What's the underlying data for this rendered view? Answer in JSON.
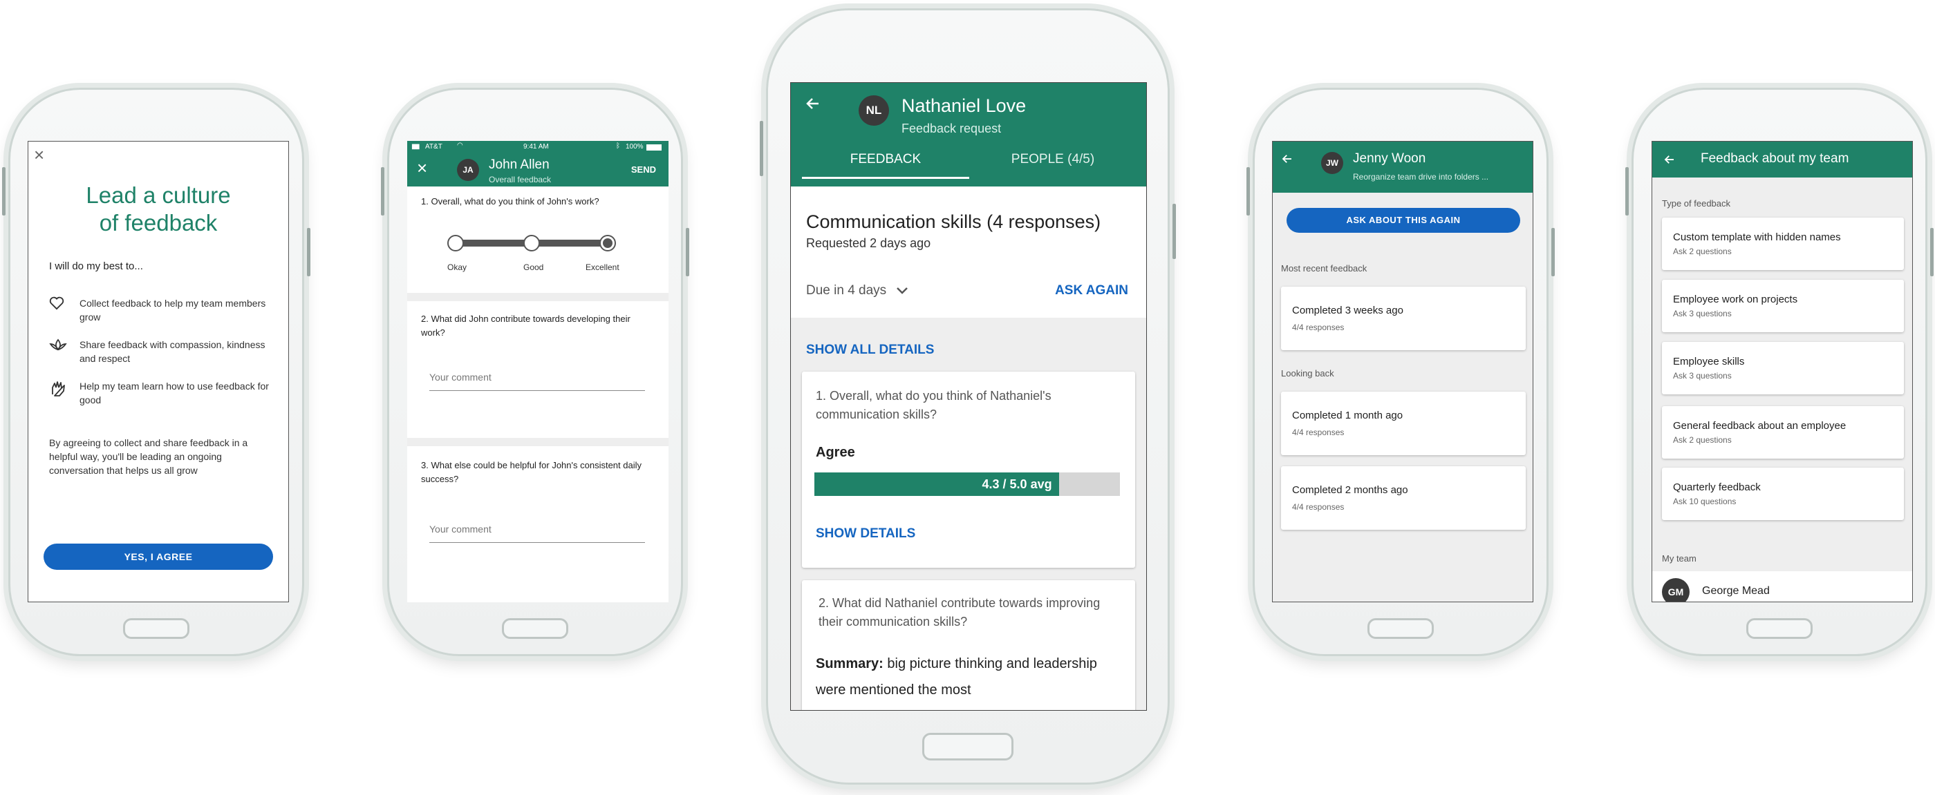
{
  "phone1": {
    "title_line1": "Lead a culture",
    "title_line2": "of feedback",
    "subtitle": "I will do my best to...",
    "pledges": [
      {
        "icon": "heart-icon",
        "text": "Collect feedback to help my team members grow"
      },
      {
        "icon": "lotus-icon",
        "text": "Share feedback with compassion, kindness and respect"
      },
      {
        "icon": "hands-icon",
        "text": "Help my team learn how to use feedback for good"
      }
    ],
    "agreement": "By agreeing to collect and share feedback in a helpful way, you'll be leading an ongoing conversation that helps us all grow",
    "agree_button": "YES, I AGREE"
  },
  "phone2": {
    "status": {
      "carrier": "AT&T",
      "time": "9:41 AM",
      "battery": "100%"
    },
    "avatar": "JA",
    "name": "John Allen",
    "subtitle": "Overall feedback",
    "send": "SEND",
    "q1": "1. Overall, what do you think of John's work?",
    "scale": [
      "Okay",
      "Good",
      "Excellent"
    ],
    "q2": "2. What did John contribute towards developing their work?",
    "comment_placeholder": "Your comment",
    "q3": "3. What else could be helpful for John's consistent daily success?",
    "comment_placeholder2": "Your comment"
  },
  "phone3": {
    "avatar": "NL",
    "name": "Nathaniel Love",
    "subtitle": "Feedback request",
    "tabs": [
      "FEEDBACK",
      "PEOPLE (4/5)"
    ],
    "heading": "Communication skills (4 responses)",
    "requested": "Requested 2 days ago",
    "due": "Due in 4 days",
    "ask_again": "ASK AGAIN",
    "show_all": "SHOW ALL DETAILS",
    "q1": "1. Overall, what do you think of Nathaniel's communication skills?",
    "q1_answer": "Agree",
    "avg_label": "4.3 / 5.0 avg",
    "avg_fraction": 0.8,
    "show_details": "SHOW DETAILS",
    "q2": "2. What did Nathaniel contribute towards improving their communication skills?",
    "summary_label": "Summary:",
    "summary_text": "big picture thinking and leadership were mentioned the most"
  },
  "phone4": {
    "avatar": "JW",
    "name": "Jenny Woon",
    "subtitle": "Reorganize team drive into folders ...",
    "ask_button": "ASK ABOUT THIS AGAIN",
    "recent_label": "Most recent feedback",
    "recent": [
      {
        "title": "Completed 3 weeks ago",
        "sub": "4/4 responses"
      }
    ],
    "back_label": "Looking back",
    "back": [
      {
        "title": "Completed 1 month ago",
        "sub": "4/4 responses"
      },
      {
        "title": "Completed 2 months ago",
        "sub": "4/4 responses"
      }
    ]
  },
  "phone5": {
    "title": "Feedback about my team",
    "type_label": "Type of feedback",
    "types": [
      {
        "title": "Custom template with hidden names",
        "sub": "Ask 2 questions"
      },
      {
        "title": "Employee work on projects",
        "sub": "Ask 3 questions"
      },
      {
        "title": "Employee skills",
        "sub": "Ask 3 questions"
      },
      {
        "title": "General feedback about an employee",
        "sub": "Ask 2 questions"
      },
      {
        "title": "Quarterly feedback",
        "sub": "Ask 10 questions"
      }
    ],
    "team_label": "My team",
    "team": [
      {
        "avatar": "GM",
        "name": "George Mead"
      }
    ]
  },
  "colors": {
    "primary_green": "#1f8268",
    "accent_blue": "#1565c0",
    "bar_gray": "#d6d6d6"
  }
}
